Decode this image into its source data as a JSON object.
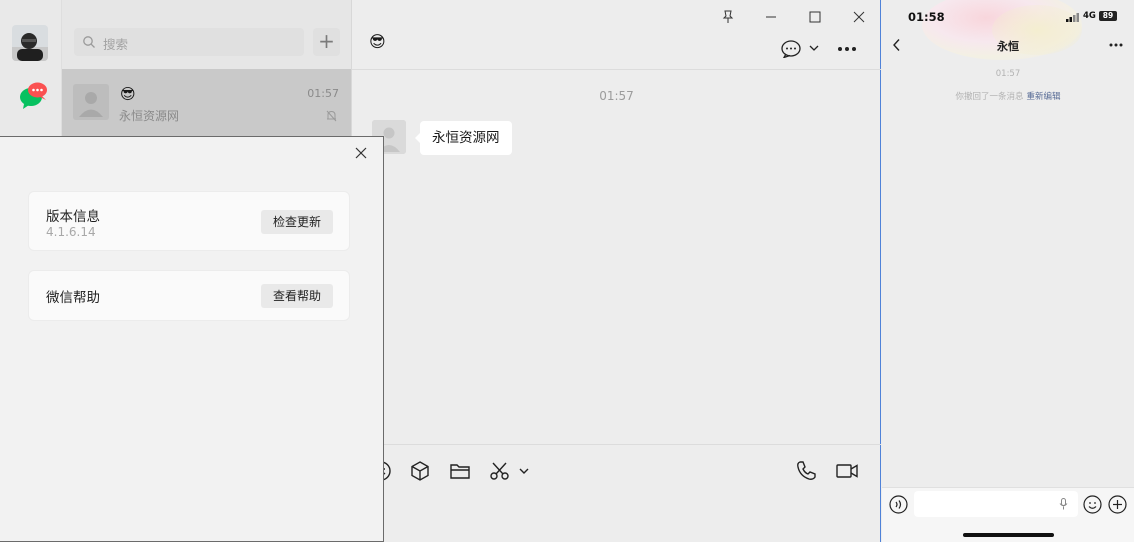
{
  "sidebar": {
    "icons": [
      "avatar",
      "chat-icon"
    ],
    "chat_badge": "···"
  },
  "chat_list": {
    "search_placeholder": "搜索",
    "plus_label": "+",
    "items": [
      {
        "name_emoji": "😎",
        "time": "01:57",
        "preview": "永恒资源网"
      }
    ]
  },
  "conversation": {
    "title_emoji": "😎",
    "messages": [
      {
        "time": "01:57",
        "text": "永恒资源网"
      }
    ],
    "toolbar_icons": [
      "emoji-icon",
      "box-icon",
      "folder-icon",
      "scissors-icon",
      "phone-icon",
      "video-icon"
    ]
  },
  "settings_popup": {
    "version_label": "版本信息",
    "version_value": "4.1.6.14",
    "check_update_label": "检查更新",
    "help_label": "微信帮助",
    "view_help_label": "查看帮助"
  },
  "phone": {
    "clock": "01:58",
    "network": "4G",
    "battery": "89",
    "contact_name": "永恒",
    "message_time": "01:57",
    "recall_text": "你撤回了一条消息",
    "reedit_text": "重新编辑"
  },
  "colors": {
    "accent_green": "#07c160",
    "badge_red": "#fa5151",
    "link_blue": "#576b95",
    "window_border_blue": "#4f82d8"
  }
}
